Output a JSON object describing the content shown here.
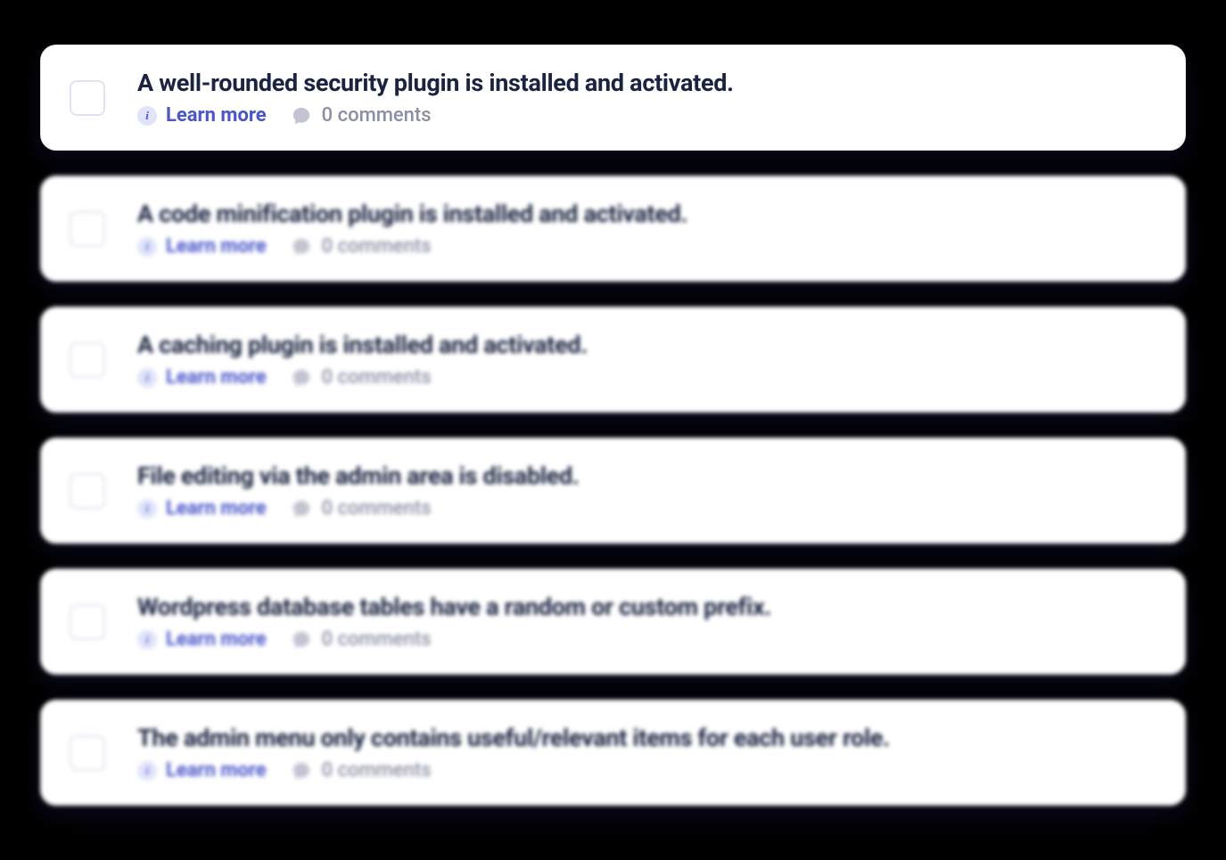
{
  "items": [
    {
      "title": "A well-rounded security plugin is installed and activated.",
      "learn_more": "Learn more",
      "comments": "0 comments",
      "focused": true
    },
    {
      "title": "A code minification plugin is installed and activated.",
      "learn_more": "Learn more",
      "comments": "0 comments",
      "focused": false
    },
    {
      "title": "A caching plugin is installed and activated.",
      "learn_more": "Learn more",
      "comments": "0 comments",
      "focused": false
    },
    {
      "title": "File editing via the admin area is disabled.",
      "learn_more": "Learn more",
      "comments": "0 comments",
      "focused": false
    },
    {
      "title": "Wordpress database tables have a random or custom prefix.",
      "learn_more": "Learn more",
      "comments": "0 comments",
      "focused": false
    },
    {
      "title": "The admin menu only contains useful/relevant items for each user role.",
      "learn_more": "Learn more",
      "comments": "0 comments",
      "focused": false
    }
  ]
}
